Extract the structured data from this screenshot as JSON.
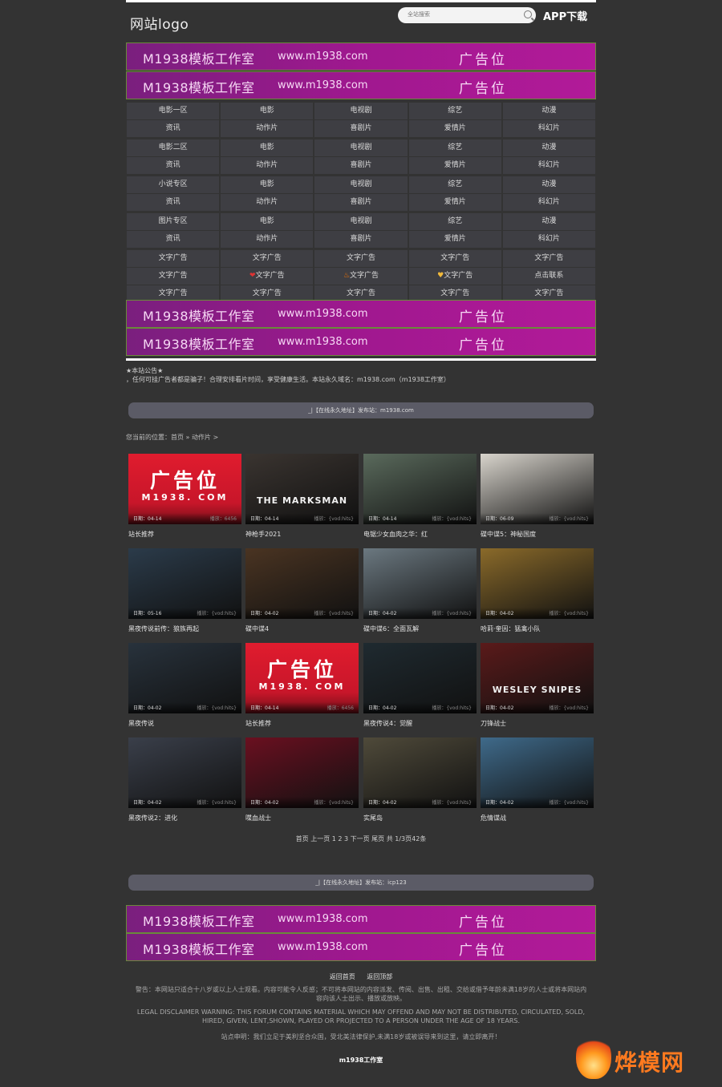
{
  "header": {
    "logo_text": "网站logo",
    "search_placeholder": "全站搜索",
    "app_download": "APP下载"
  },
  "banner": {
    "title": "M1938模板工作室",
    "url": "www.m1938.com",
    "tag": "广告位"
  },
  "nav": {
    "rows": [
      [
        "电影一区",
        "电影",
        "电视剧",
        "综艺",
        "动漫"
      ],
      [
        "资讯",
        "动作片",
        "喜剧片",
        "爱情片",
        "科幻片"
      ],
      [
        "电影二区",
        "电影",
        "电视剧",
        "综艺",
        "动漫"
      ],
      [
        "资讯",
        "动作片",
        "喜剧片",
        "爱情片",
        "科幻片"
      ],
      [
        "小说专区",
        "电影",
        "电视剧",
        "综艺",
        "动漫"
      ],
      [
        "资讯",
        "动作片",
        "喜剧片",
        "爱情片",
        "科幻片"
      ],
      [
        "图片专区",
        "电影",
        "电视剧",
        "综艺",
        "动漫"
      ],
      [
        "资讯",
        "动作片",
        "喜剧片",
        "爱情片",
        "科幻片"
      ],
      [
        "文字广告",
        "文字广告",
        "文字广告",
        "文字广告",
        "文字广告"
      ],
      [
        "文字广告",
        "文字广告",
        "文字广告",
        "文字广告",
        "点击联系"
      ],
      [
        "文字广告",
        "文字广告",
        "文字广告",
        "文字广告",
        "文字广告"
      ]
    ]
  },
  "notice": {
    "title": "★本站公告★",
    "text": "，任何可挂广告者都是骗子！合理安排看片时间，享受健康生活。本站永久域名：m1938.com（m1938工作室）"
  },
  "pill_top": "_|【在线永久地址】发布站：m1938.com",
  "pill_bottom": "_|【在线永久地址】发布站：icp123",
  "breadcrumb": {
    "label": "您当前的位置：",
    "home": "首页",
    "sep": "»",
    "current": "动作片",
    "tail": ">"
  },
  "ad_card": {
    "title": "广告位",
    "sub": "M1938. COM"
  },
  "cards": [
    {
      "title": "站长推荐",
      "date": "日期：04-14",
      "hits": "播放：6456",
      "kind": "ad",
      "bg": "#d21a2a"
    },
    {
      "title": "神枪手2021",
      "date": "日期：04-14",
      "hits": "播放：{vod:hits}",
      "kind": "movie",
      "poster": "THE MARKSMAN",
      "bg": "#3a3430"
    },
    {
      "title": "电锯少女血肉之华：红",
      "date": "日期：04-14",
      "hits": "播放：{vod:hits}",
      "kind": "movie",
      "poster": "",
      "bg": "#5a6a5c"
    },
    {
      "title": "碟中谍5：神秘国度",
      "date": "日期：06-09",
      "hits": "播放：{vod:hits}",
      "kind": "movie",
      "poster": "",
      "bg": "#d8d4cc"
    },
    {
      "title": "黑夜传说前传：狼族再起",
      "date": "日期：05-16",
      "hits": "播放：{vod:hits}",
      "kind": "movie",
      "poster": "",
      "bg": "#2b3b4a"
    },
    {
      "title": "碟中谍4",
      "date": "日期：04-02",
      "hits": "播放：{vod:hits}",
      "kind": "movie",
      "poster": "",
      "bg": "#4a3422"
    },
    {
      "title": "碟中谍6：全面瓦解",
      "date": "日期：04-02",
      "hits": "播放：{vod:hits}",
      "kind": "movie",
      "poster": "",
      "bg": "#6b7880"
    },
    {
      "title": "哈莉·奎因：猛禽小队",
      "date": "日期：04-02",
      "hits": "播放：{vod:hits}",
      "kind": "movie",
      "poster": "",
      "bg": "#8a6a2a"
    },
    {
      "title": "黑夜传说",
      "date": "日期：04-02",
      "hits": "播放：{vod:hits}",
      "kind": "movie",
      "poster": "",
      "bg": "#28323c"
    },
    {
      "title": "站长推荐",
      "date": "日期：04-14",
      "hits": "播放：6456",
      "kind": "ad",
      "bg": "#d21a2a"
    },
    {
      "title": "黑夜传说4：觉醒",
      "date": "日期：04-02",
      "hits": "播放：{vod:hits}",
      "kind": "movie",
      "poster": "",
      "bg": "#1f2a30"
    },
    {
      "title": "刀锋战士",
      "date": "日期：04-02",
      "hits": "播放：{vod:hits}",
      "kind": "movie",
      "poster": "WESLEY SNIPES",
      "bg": "#5a1a1a"
    },
    {
      "title": "黑夜传说2：进化",
      "date": "日期：04-02",
      "hits": "播放：{vod:hits}",
      "kind": "movie",
      "poster": "",
      "bg": "#3a3f4a"
    },
    {
      "title": "喋血战士",
      "date": "日期：04-02",
      "hits": "播放：{vod:hits}",
      "kind": "movie",
      "poster": "",
      "bg": "#6a1020"
    },
    {
      "title": "实尾岛",
      "date": "日期：04-02",
      "hits": "播放：{vod:hits}",
      "kind": "movie",
      "poster": "",
      "bg": "#4f4a3a"
    },
    {
      "title": "危情谍战",
      "date": "日期：04-02",
      "hits": "播放：{vod:hits}",
      "kind": "movie",
      "poster": "",
      "bg": "#3f6a8a"
    }
  ],
  "pager": "首页 上一页 1 2 3 下一页 尾页 共 1/3页42条",
  "footer": {
    "links": [
      "返回首页",
      "返回顶部"
    ],
    "warning_cn": "警告：本网站只适合十八岁或以上人士观看。内容可能令人反感；不可将本网站的内容派发、传阅、出售、出租、交给或借予年龄未满18岁的人士或将本网站内容向该人士出示、播放或放映。",
    "warning_en": "LEGAL DISCLAIMER WARNING: THIS FORUM CONTAINS MATERIAL WHICH MAY OFFEND AND MAY NOT BE DISTRIBUTED, CIRCULATED, SOLD, HIRED, GIVEN, LENT,SHOWN, PLAYED OR PROJECTED TO A PERSON UNDER THE AGE OF 18 YEARS.",
    "statement": "站点申明：我们立足于美利坚合众国，受北美法律保护,未满18岁或被误导来到这里，请立即离开！",
    "copyright": "m1938工作室"
  },
  "watermark": "烨模网"
}
